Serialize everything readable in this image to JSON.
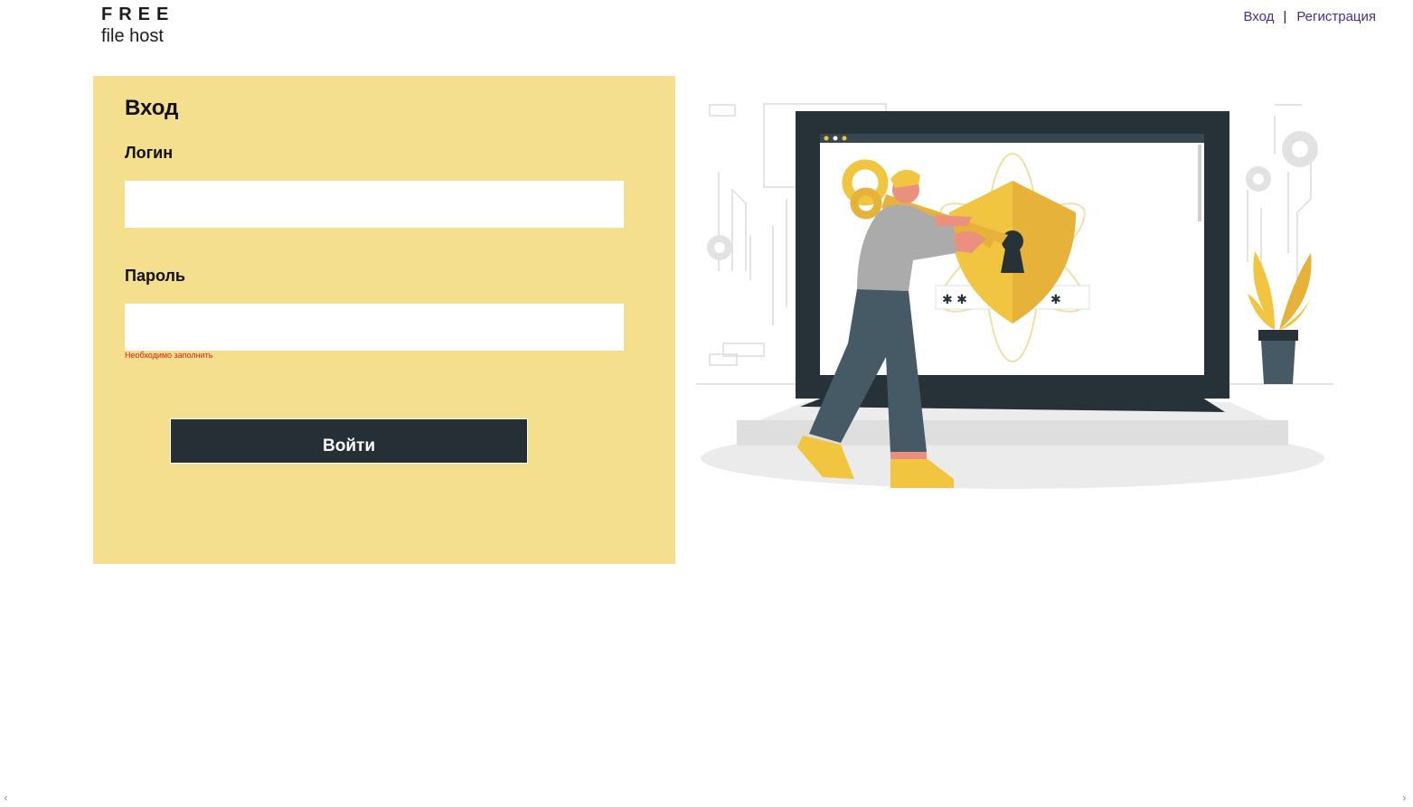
{
  "header": {
    "logo_top": "FREE",
    "logo_bottom": "file host",
    "nav": {
      "login": "Вход",
      "separator": "|",
      "register": "Регистрация"
    }
  },
  "form": {
    "title": "Вход",
    "login_label": "Логин",
    "login_value": "",
    "password_label": "Пароль",
    "password_value": "",
    "password_error": "Необходимо заполнить",
    "submit_label": "Войти"
  },
  "illustration": {
    "icon": "security-key-illustration",
    "password_mask": "✱ ✱",
    "password_mask_end": "✱"
  },
  "scroll": {
    "left_icon": "chevron-left-icon",
    "right_icon": "chevron-right-icon",
    "left": "‹",
    "right": "›"
  },
  "colors": {
    "panel": "#f3df8e",
    "button": "#252f35",
    "error": "#e21b1b",
    "nav_link": "#4a2c8a",
    "accent_yellow": "#f2c541",
    "dark_slate": "#263238"
  }
}
